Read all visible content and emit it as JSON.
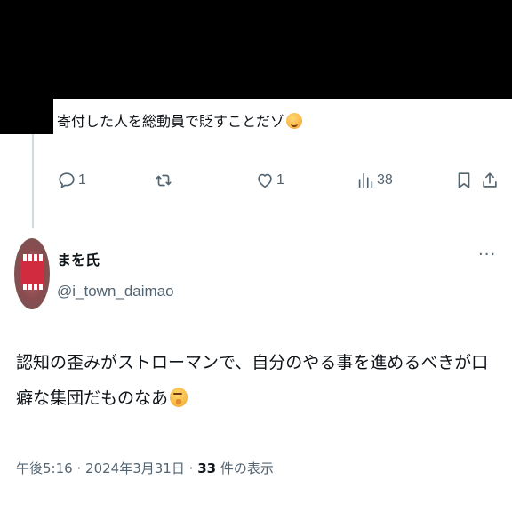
{
  "previous_tweet": {
    "text": "寄付した人を総動員で貶すことだゾ",
    "emoji": "hugging-face-emoji",
    "actions": {
      "reply_count": "1",
      "repost_count": "",
      "like_count": "1",
      "views_count": "38"
    }
  },
  "tweet": {
    "display_name": "まを氏",
    "handle": "@i_town_daimao",
    "text": "認知の歪みがストローマンで、自分のやる事を進めるべきが口癖な集団だものなあ",
    "emoji": "thinking-face-emoji",
    "time": "午後5:16",
    "date": "2024年3月31日",
    "views_number": "33",
    "views_label": "件の表示",
    "separator": "·"
  },
  "colors": {
    "text": "#0f1419",
    "secondary": "#536471",
    "thread_line": "#cfd9de"
  }
}
